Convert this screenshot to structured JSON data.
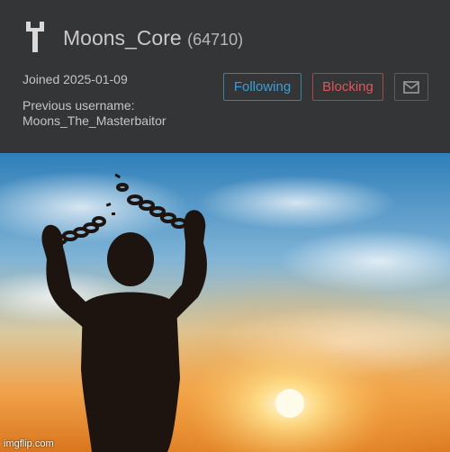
{
  "profile": {
    "username": "Moons_Core",
    "points": "(64710)",
    "joined": "Joined 2025-01-09",
    "previous_username_label": "Previous username:",
    "previous_username": "Moons_The_Masterbaitor"
  },
  "actions": {
    "following_label": "Following",
    "blocking_label": "Blocking",
    "message_icon": "mail-icon"
  },
  "image": {
    "description_icon": "broken-chains-silhouette",
    "watermark": "imgflip.com"
  },
  "colors": {
    "panel_bg": "#343537",
    "following": "#3b9ed8",
    "blocking": "#e05555"
  }
}
